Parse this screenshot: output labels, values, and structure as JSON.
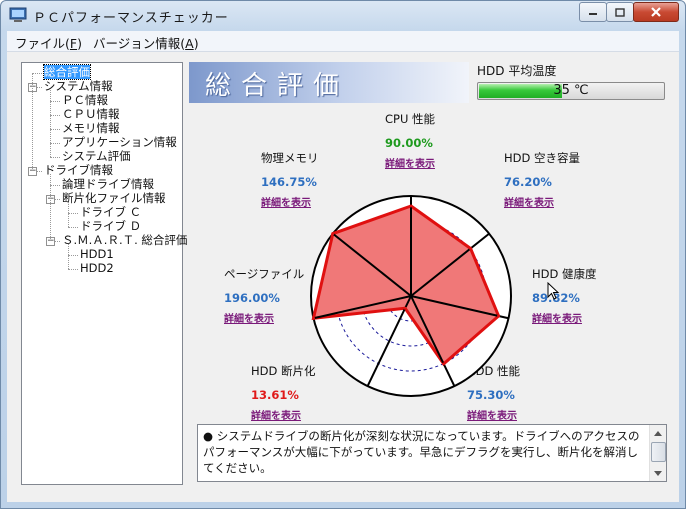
{
  "window": {
    "title": "ＰＣパフォーマンスチェッカー"
  },
  "menu": [
    {
      "label": "ファイル(",
      "accel": "F",
      "suffix": ")"
    },
    {
      "label": "バージョン情報(",
      "accel": "A",
      "suffix": ")"
    }
  ],
  "tree": [
    {
      "label": "総合評価",
      "level": 0,
      "selected": true
    },
    {
      "label": "システム情報",
      "level": 0,
      "expander": "−"
    },
    {
      "label": "ＰＣ情報",
      "level": 1
    },
    {
      "label": "ＣＰＵ情報",
      "level": 1
    },
    {
      "label": "メモリ情報",
      "level": 1
    },
    {
      "label": "アプリケーション情報",
      "level": 1
    },
    {
      "label": "システム評価",
      "level": 1
    },
    {
      "label": "ドライブ情報",
      "level": 0,
      "expander": "−"
    },
    {
      "label": "論理ドライブ情報",
      "level": 1
    },
    {
      "label": "断片化ファイル情報",
      "level": 1,
      "expander": "−"
    },
    {
      "label": "ドライブ Ｃ",
      "level": 2
    },
    {
      "label": "ドライブ Ｄ",
      "level": 2
    },
    {
      "label": "Ｓ.Ｍ.Ａ.Ｒ.Ｔ. 総合評価",
      "level": 1,
      "expander": "−"
    },
    {
      "label": "HDD1",
      "level": 2
    },
    {
      "label": "HDD2",
      "level": 2
    }
  ],
  "header": {
    "title": "総合評価"
  },
  "hdd_temp": {
    "label": "HDD 平均温度",
    "value": "35 ℃",
    "level": 0.45,
    "fill_color": "#2fbf35"
  },
  "metrics": {
    "cpu": {
      "label": "CPU 性能",
      "value": "90.00%",
      "value_num": 90.0,
      "color": "#1e9a1e",
      "link": "詳細を表示"
    },
    "hdd_free": {
      "label": "HDD 空き容量",
      "value": "76.20%",
      "value_num": 76.2,
      "color": "#2e6fc0",
      "link": "詳細を表示"
    },
    "hdd_health": {
      "label": "HDD 健康度",
      "value": "89.82%",
      "value_num": 89.82,
      "color": "#2e6fc0",
      "link": "詳細を表示"
    },
    "hdd_perf": {
      "label": "HDD 性能",
      "value": "75.30%",
      "value_num": 75.3,
      "color": "#2e6fc0",
      "link": "詳細を表示"
    },
    "hdd_frag": {
      "label": "HDD 断片化",
      "value": "13.61%",
      "value_num": 13.61,
      "color": "#e01a1a",
      "link": "詳細を表示"
    },
    "pagefile": {
      "label": "ページファイル",
      "value": "196.00%",
      "value_num": 196.0,
      "color": "#2e6fc0",
      "link": "詳細を表示"
    },
    "memory": {
      "label": "物理メモリ",
      "value": "146.75%",
      "value_num": 146.75,
      "color": "#2e6fc0",
      "link": "詳細を表示"
    }
  },
  "radar_colors": {
    "fill": "#f07878",
    "stroke": "#e01010",
    "grid": "#1a1a9a"
  },
  "message": "● システムドライブの断片化が深刻な状況になっています。ドライブへのアクセスのパフォーマンスが大幅に下がっています。早急にデフラグを実行し、断片化を解消してください。"
}
